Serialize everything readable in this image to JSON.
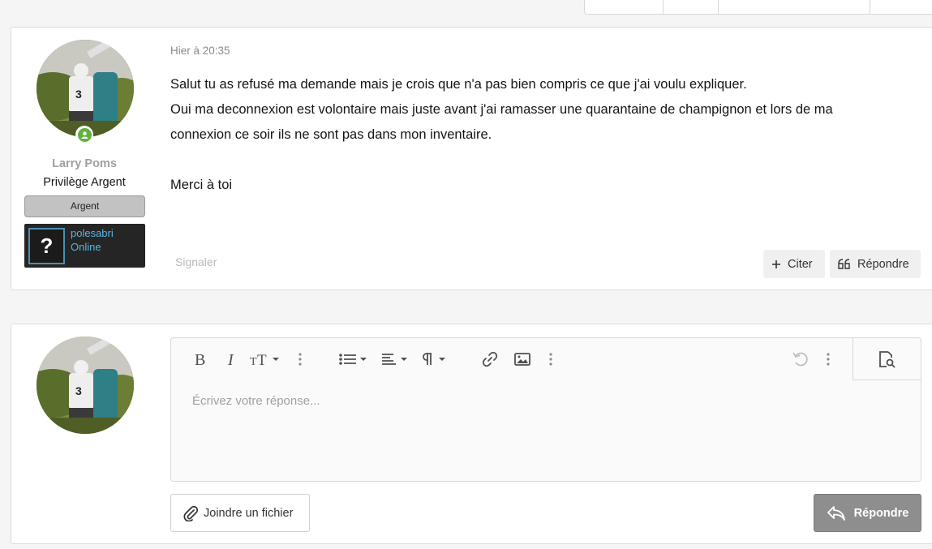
{
  "message": {
    "author": {
      "name": "Larry Poms",
      "title": "Privilège Argent",
      "banner": "Argent",
      "steam_name": "polesabri",
      "steam_status": "Online",
      "steam_placeholder": "?"
    },
    "date": "Hier à 20:35",
    "body": [
      "Salut tu as refusé ma demande mais je crois que n'a pas bien compris ce que j'ai voulu expliquer.",
      "Oui ma deconnexion est volontaire mais juste avant j'ai ramasser une quarantaine de champignon et lors de ma",
      "connexion ce soir ils ne sont pas dans mon inventaire.",
      "",
      "Merci à toi"
    ],
    "report_label": "Signaler",
    "quote_label": "Citer",
    "reply_label": "Répondre"
  },
  "reply_form": {
    "placeholder": "Écrivez votre réponse...",
    "attach_label": "Joindre un fichier",
    "submit_label": "Répondre",
    "toolbar_icons": [
      "bold-icon",
      "italic-icon",
      "text-size-icon",
      "more-vertical-icon",
      "list-icon",
      "align-icon",
      "paragraph-icon",
      "more-vertical-icon",
      "link-icon",
      "image-icon",
      "more-vertical-icon",
      "undo-icon",
      "more-vertical-icon",
      "preview-icon"
    ]
  },
  "colors": {
    "online": "#62b33d",
    "steam_accent": "#58b6e3",
    "submit_bg": "#8e8e8e"
  }
}
